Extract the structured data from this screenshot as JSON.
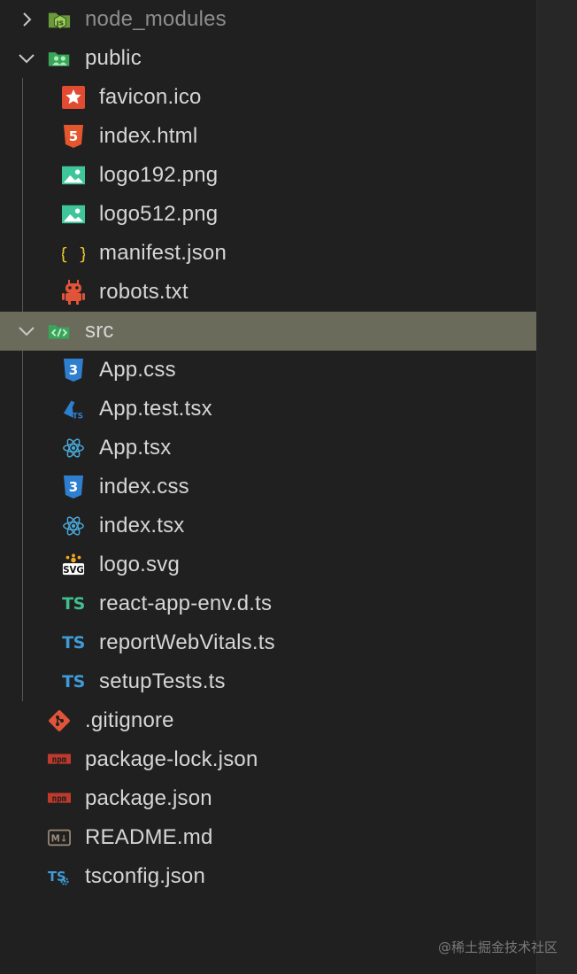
{
  "explorer": {
    "root": [
      {
        "name": "node_modules",
        "state": "collapsed",
        "icon": "nodejs-folder-icon"
      },
      {
        "name": "public",
        "state": "expanded",
        "icon": "public-folder-icon"
      },
      {
        "name": "src",
        "state": "expanded",
        "selected": true,
        "icon": "src-folder-icon"
      },
      {
        "name": ".gitignore",
        "icon": "git-icon"
      },
      {
        "name": "package-lock.json",
        "icon": "npm-icon"
      },
      {
        "name": "package.json",
        "icon": "npm-icon"
      },
      {
        "name": "README.md",
        "icon": "markdown-icon"
      },
      {
        "name": "tsconfig.json",
        "icon": "tsconfig-icon"
      }
    ],
    "public_files": [
      {
        "name": "favicon.ico",
        "icon": "favicon-star-icon"
      },
      {
        "name": "index.html",
        "icon": "html5-icon"
      },
      {
        "name": "logo192.png",
        "icon": "image-icon"
      },
      {
        "name": "logo512.png",
        "icon": "image-icon"
      },
      {
        "name": "manifest.json",
        "icon": "json-braces-icon"
      },
      {
        "name": "robots.txt",
        "icon": "robot-icon"
      }
    ],
    "src_files": [
      {
        "name": "App.css",
        "icon": "css3-icon"
      },
      {
        "name": "App.test.tsx",
        "icon": "test-flask-icon"
      },
      {
        "name": "App.tsx",
        "icon": "react-icon"
      },
      {
        "name": "index.css",
        "icon": "css3-icon"
      },
      {
        "name": "index.tsx",
        "icon": "react-icon"
      },
      {
        "name": "logo.svg",
        "icon": "svg-icon"
      },
      {
        "name": "react-app-env.d.ts",
        "icon": "typescript-def-icon"
      },
      {
        "name": "reportWebVitals.ts",
        "icon": "typescript-icon"
      },
      {
        "name": "setupTests.ts",
        "icon": "typescript-icon"
      }
    ]
  },
  "icon_text": {
    "css": "3",
    "html": "5",
    "ts": "TS",
    "braces": "{ }",
    "svg": "SVG",
    "md": "M↓",
    "npm": "npm"
  },
  "colors": {
    "selected_row": "#6b6b5c",
    "text": "#d6d6d6",
    "dim_text": "#8d8d8d",
    "ts_blue": "#3f9bd8",
    "ts_green": "#3fbf8f",
    "react_blue": "#4aa8d8",
    "html_orange": "#e4572e",
    "npm_red": "#c0392b",
    "git_orange": "#e2543a",
    "image_green": "#3ec59a"
  },
  "watermark": "@稀土掘金技术社区"
}
